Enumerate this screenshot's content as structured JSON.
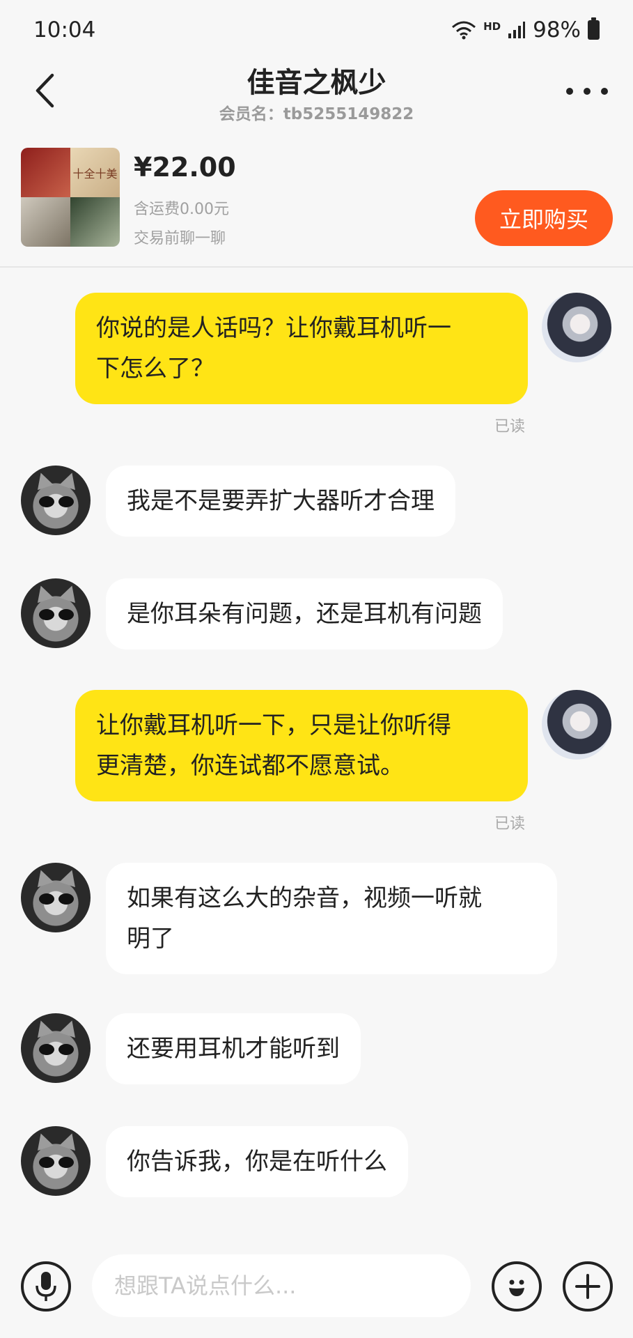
{
  "status_bar": {
    "time": "10:04",
    "hd": "HD",
    "battery": "98%"
  },
  "header": {
    "title": "佳音之枫少",
    "subtitle": "会员名：tb5255149822"
  },
  "product": {
    "thumb_text": "十全十美",
    "price": "¥22.00",
    "shipping": "含运费0.00元",
    "chat_note": "交易前聊一聊",
    "buy_label": "立即购买"
  },
  "messages": [
    {
      "sender": "me",
      "text": "你说的是人话吗？让你戴耳机听一\n下怎么了？",
      "status": "已读"
    },
    {
      "sender": "them",
      "text": "我是不是要弄扩大器听才合理"
    },
    {
      "sender": "them",
      "text": "是你耳朵有问题，还是耳机有问题"
    },
    {
      "sender": "me",
      "text": "让你戴耳机听一下，只是让你听得\n更清楚，你连试都不愿意试。",
      "status": "已读"
    },
    {
      "sender": "them",
      "text": "如果有这么大的杂音，视频一听就\n明了"
    },
    {
      "sender": "them",
      "text": "还要用耳机才能听到"
    },
    {
      "sender": "them",
      "text": "你告诉我，你是在听什么"
    }
  ],
  "input": {
    "placeholder": "想跟TA说点什么..."
  },
  "colors": {
    "my_bubble": "#ffe415",
    "their_bubble": "#ffffff",
    "buy_button": "#ff5a1f",
    "background": "#f7f7f7"
  }
}
